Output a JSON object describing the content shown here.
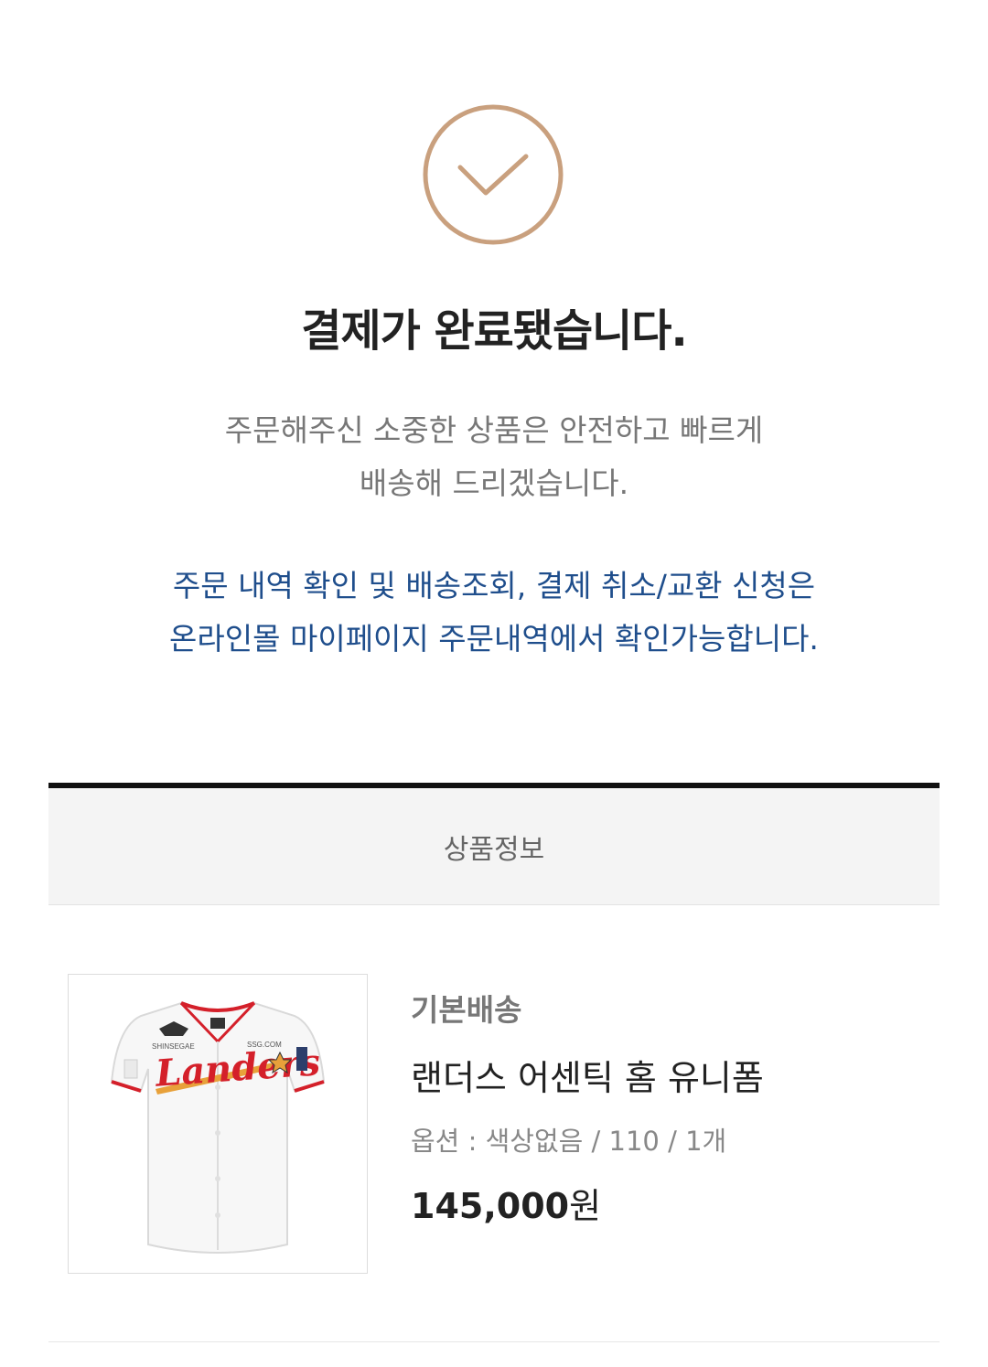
{
  "success": {
    "icon": "checkmark-circle-icon",
    "title": "결제가 완료됐습니다.",
    "message_line1": "주문해주신 소중한 상품은 안전하고 빠르게",
    "message_line2": "배송해 드리겠습니다.",
    "notice_line1": "주문 내역 확인 및 배송조회, 결제 취소/교환 신청은",
    "notice_line2": "온라인몰 마이페이지 주문내역에서 확인가능합니다."
  },
  "section": {
    "header": "상품정보"
  },
  "product": {
    "delivery_type": "기본배송",
    "name": "랜더스 어센틱 홈 유니폼",
    "option_label": "옵션 : ",
    "option_value": "색상없음 / 110 / 1개",
    "price": "145,000",
    "price_unit": "원",
    "image": {
      "icon": "jersey-image",
      "lettering": "Landers",
      "sponsor_left": "SHINSEGAE",
      "sponsor_right": "SSG.COM"
    }
  },
  "colors": {
    "accent_check": "#c9a07e",
    "notice_blue": "#1f4e8c",
    "jersey_red": "#d4202a"
  }
}
